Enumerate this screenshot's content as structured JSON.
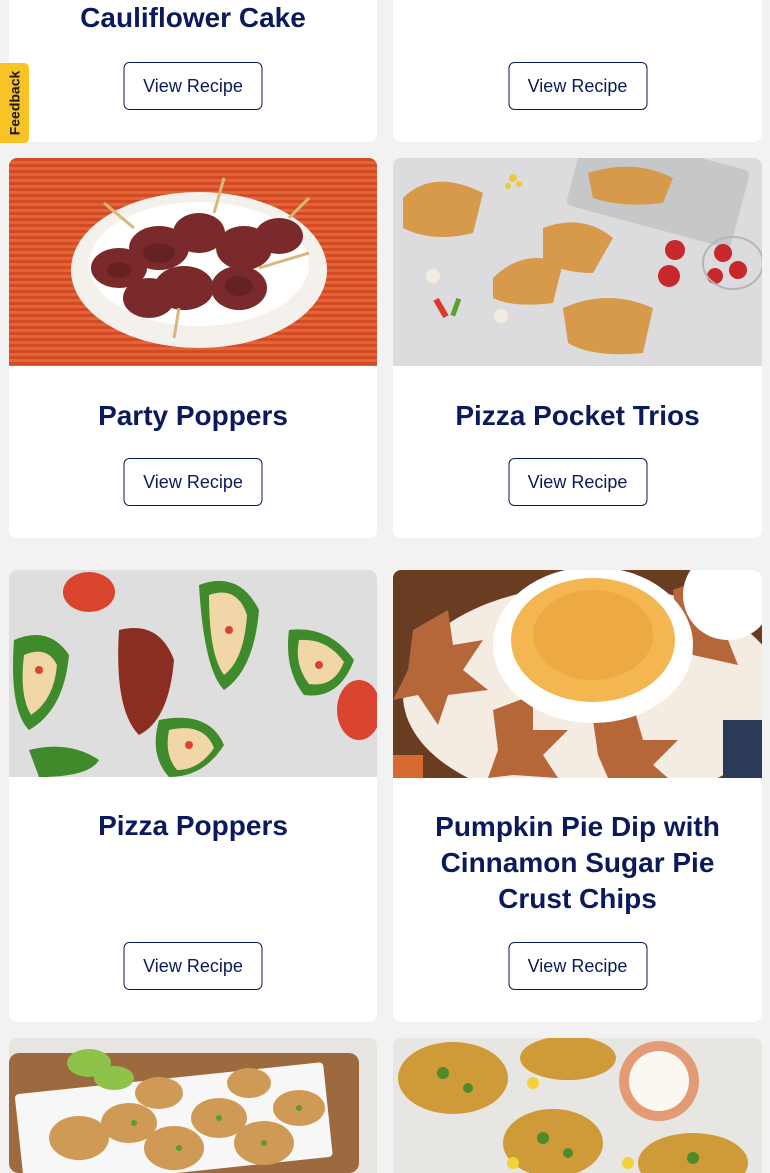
{
  "feedback_label": "Feedback",
  "cards": [
    {
      "title": "Cauliflower Cake",
      "button": "View Recipe"
    },
    {
      "title": "",
      "button": "View Recipe"
    },
    {
      "title": "Party Poppers",
      "button": "View Recipe"
    },
    {
      "title": "Pizza Pocket Trios",
      "button": "View Recipe"
    },
    {
      "title": "Pizza Poppers",
      "button": "View Recipe"
    },
    {
      "title": "Pumpkin Pie Dip with Cinnamon Sugar Pie Crust Chips",
      "button": "View Recipe"
    }
  ],
  "colors": {
    "title": "#0b1a5c",
    "background": "#f2f2f2",
    "feedback_tab": "#f7c325"
  }
}
